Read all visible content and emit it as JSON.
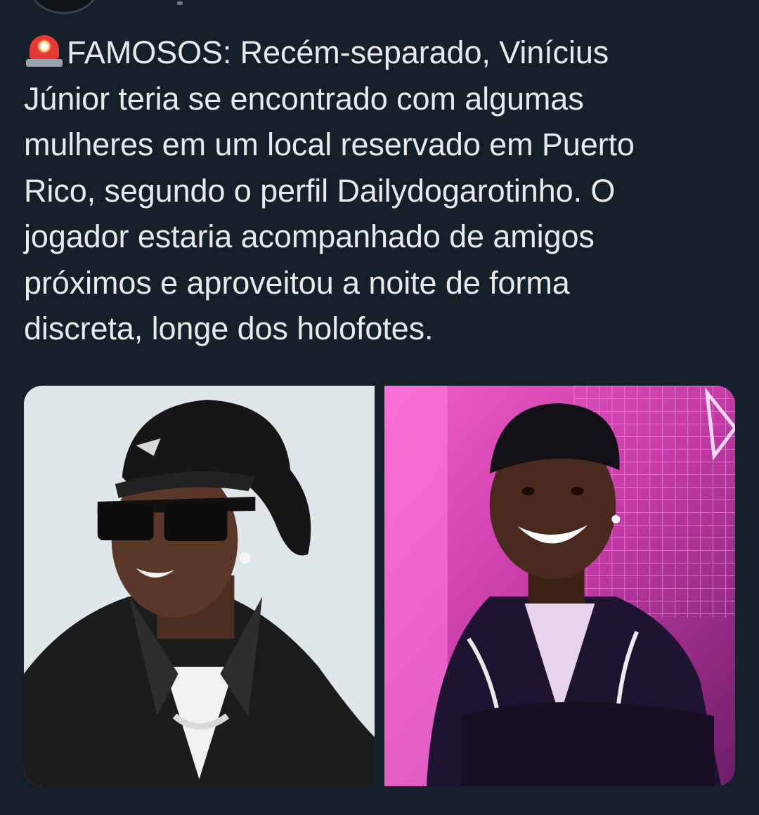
{
  "tweet": {
    "emoji_icon": "police-car-light-icon",
    "text": "FAMOSOS: Recém-separado, Vinícius\nJúnior teria se encontrado com algumas\nmulheres em um local reservado em Puerto\nRico, segundo o perfil Dailydogarotinho. O\njogador estaria acompanhado de amigos\npróximos e aproveitou a noite de forma\ndiscreta, longe dos holofotes."
  },
  "media": {
    "photos": [
      {
        "icon": "photo-man-in-prada-bucket-hat-sunglasses"
      },
      {
        "icon": "photo-man-smiling-neon-pink-background"
      }
    ]
  },
  "colors": {
    "background": "#15202b",
    "text": "#e7e9ea",
    "siren_red": "#e53935"
  }
}
